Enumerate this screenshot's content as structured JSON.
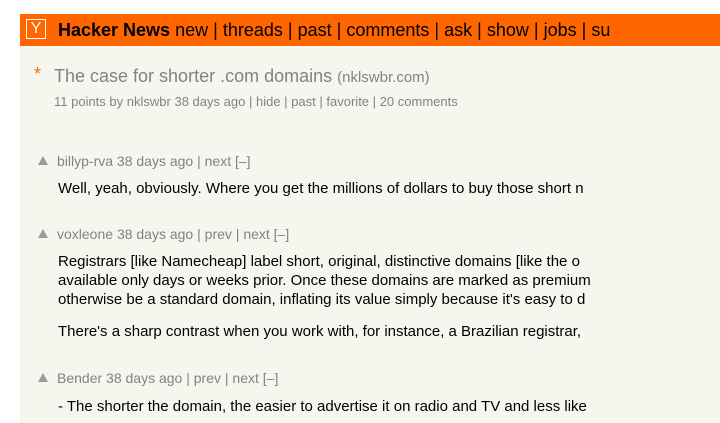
{
  "header": {
    "logo_letter": "Y",
    "site_name": "Hacker News",
    "nav": [
      "new",
      "threads",
      "past",
      "comments",
      "ask",
      "show",
      "jobs",
      "su"
    ],
    "background": "#ff6600"
  },
  "story": {
    "title": "The case for shorter .com domains",
    "domain": "(nklswbr.com)",
    "subtext": {
      "points": "11 points",
      "by": "by",
      "user": "nklswbr",
      "age": "38 days ago",
      "hide": "hide",
      "past": "past",
      "favorite": "favorite",
      "comments": "20 comments"
    }
  },
  "comments": [
    {
      "user": "billyp-rva",
      "age": "38 days ago",
      "links": [
        "next",
        "[–]"
      ],
      "paragraphs": [
        [
          "Well, yeah, obviously. Where you get the millions of dollars to buy those short n"
        ]
      ]
    },
    {
      "user": "voxleone",
      "age": "38 days ago",
      "links": [
        "prev",
        "next",
        "[–]"
      ],
      "paragraphs": [
        [
          "Registrars [like Namecheap] label short, original, distinctive domains [like the o",
          "available only days or weeks prior. Once these domains are marked as premium",
          "otherwise be a standard domain, inflating its value simply because it's easy to d"
        ],
        [
          "There's a sharp contrast when you work with, for instance, a Brazilian registrar,"
        ]
      ]
    },
    {
      "user": "Bender",
      "age": "38 days ago",
      "links": [
        "prev",
        "next",
        "[–]"
      ],
      "paragraphs": [
        [
          "- The shorter the domain, the easier to advertise it on radio and TV and less like"
        ]
      ]
    }
  ]
}
